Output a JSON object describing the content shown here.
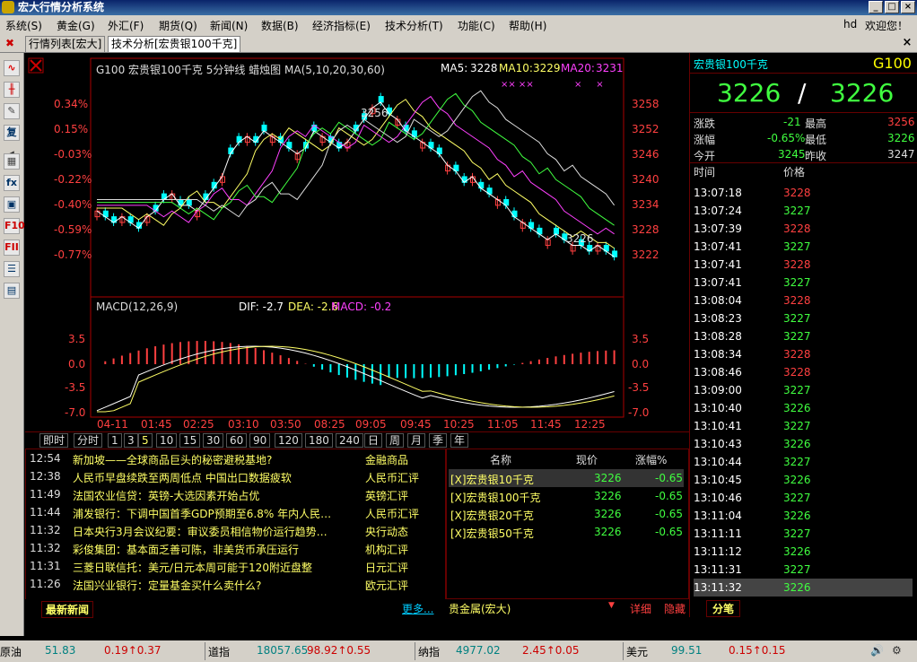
{
  "app": {
    "title": "宏大行情分析系统"
  },
  "menu": {
    "items": [
      "系统(S)",
      "黄金(G)",
      "外汇(F)",
      "期货(Q)",
      "新闻(N)",
      "数据(B)",
      "经济指标(E)",
      "技术分析(T)",
      "功能(C)",
      "帮助(H)"
    ],
    "user": "hd",
    "welcome": "欢迎您！"
  },
  "tabs": [
    "行情列表[宏大]",
    "技术分析[宏贵银100千克]"
  ],
  "chart": {
    "header": "G100 宏贵银100千克 5分钟线 蜡烛图 MA(5,10,20,30,60)",
    "ma5_label": "MA5:",
    "ma5": "3228",
    "ma10_label": "MA10:",
    "ma10": "3229",
    "ma20_label": "MA20:",
    "ma20": "3231",
    "pct_labels": [
      "0.34%",
      "0.15%",
      "-0.03%",
      "-0.22%",
      "-0.40%",
      "-0.59%",
      "-0.77%"
    ],
    "price_labels": [
      "3258",
      "3252",
      "3246",
      "3240",
      "3234",
      "3228",
      "3222"
    ],
    "high_annot": "3256",
    "low_annot": "3226",
    "macd_header": "MACD(12,26,9)",
    "dif": "DIF: -2.7",
    "dea": "DEA: -2.6",
    "macd": "MACD: -0.2",
    "macd_labels": [
      "3.5",
      "0.0",
      "-3.5",
      "-7.0"
    ],
    "x_labels": [
      "04-11",
      "01:45",
      "02:25",
      "03:10",
      "03:50",
      "08:25",
      "09:05",
      "09:45",
      "10:25",
      "11:05",
      "11:45",
      "12:25"
    ]
  },
  "chart_data": {
    "type": "candlestick",
    "title": "G100 宏贵银100千克 5分钟线",
    "ylim": [
      3220,
      3260
    ],
    "high": 3256,
    "low": 3226,
    "last": 3226
  },
  "periods": [
    "即时",
    "分时",
    "1",
    "3",
    "5",
    "10",
    "15",
    "30",
    "60",
    "90",
    "120",
    "180",
    "240",
    "日",
    "周",
    "月",
    "季",
    "年"
  ],
  "news": [
    {
      "time": "12:54",
      "headline": "新加坡——全球商品巨头的秘密避税基地?",
      "cat": "金融商品"
    },
    {
      "time": "12:38",
      "headline": "人民币早盘续跌至两周低点 中国出口数据疲软",
      "cat": "人民币汇评"
    },
    {
      "time": "11:49",
      "headline": "法国农业信贷：英镑-大选因素开始占优",
      "cat": "英镑汇评"
    },
    {
      "time": "11:44",
      "headline": "浦发银行：下调中国首季GDP预期至6.8% 年内人民…",
      "cat": "人民币汇评"
    },
    {
      "time": "11:32",
      "headline": "日本央行3月会议纪要：审议委员相信物价运行趋势…",
      "cat": "央行动态"
    },
    {
      "time": "11:32",
      "headline": "彩俊集团：基本面乏善可陈，非美货币承压运行",
      "cat": "机构汇评"
    },
    {
      "time": "11:31",
      "headline": "三菱日联信托：美元/日元本周可能于120附近盘整",
      "cat": "日元汇评"
    },
    {
      "time": "11:26",
      "headline": "法国兴业银行：定量基金买什么卖什么?",
      "cat": "欧元汇评"
    }
  ],
  "news_tab": "最新新闻",
  "news_more": "更多...",
  "watch": {
    "headers": [
      "名称",
      "现价",
      "涨幅%"
    ],
    "rows": [
      {
        "name": "[X]宏贵银10千克",
        "price": "3226",
        "chg": "-0.65"
      },
      {
        "name": "[X]宏贵银100千克",
        "price": "3226",
        "chg": "-0.65"
      },
      {
        "name": "[X]宏贵银20千克",
        "price": "3226",
        "chg": "-0.65"
      },
      {
        "name": "[X]宏贵银50千克",
        "price": "3226",
        "chg": "-0.65"
      }
    ],
    "footer": "贵金属(宏大)",
    "detail": "详细",
    "hide": "隐藏"
  },
  "quote": {
    "name": "宏贵银100千克",
    "code": "G100",
    "bid": "3226",
    "ask": "3226",
    "sep": "/",
    "chg_label": "涨跌",
    "chg": "-21",
    "high_label": "最高",
    "high": "3256",
    "pct_label": "涨幅",
    "pct": "-0.65%",
    "low_label": "最低",
    "low": "3226",
    "open_label": "今开",
    "open": "3245",
    "prev_label": "昨收",
    "prev": "3247",
    "time_label": "时间",
    "price_label": "价格",
    "tab": "分笔"
  },
  "ticks": [
    [
      "13:07:18",
      "3228"
    ],
    [
      "13:07:24",
      "3227"
    ],
    [
      "13:07:39",
      "3228"
    ],
    [
      "13:07:41",
      "3227"
    ],
    [
      "13:07:41",
      "3228"
    ],
    [
      "13:07:41",
      "3227"
    ],
    [
      "13:08:04",
      "3228"
    ],
    [
      "13:08:23",
      "3227"
    ],
    [
      "13:08:28",
      "3227"
    ],
    [
      "13:08:34",
      "3228"
    ],
    [
      "13:08:46",
      "3228"
    ],
    [
      "13:09:00",
      "3227"
    ],
    [
      "13:10:40",
      "3226"
    ],
    [
      "13:10:41",
      "3227"
    ],
    [
      "13:10:43",
      "3226"
    ],
    [
      "13:10:44",
      "3227"
    ],
    [
      "13:10:45",
      "3226"
    ],
    [
      "13:10:46",
      "3227"
    ],
    [
      "13:11:04",
      "3226"
    ],
    [
      "13:11:11",
      "3227"
    ],
    [
      "13:11:12",
      "3226"
    ],
    [
      "13:11:31",
      "3227"
    ],
    [
      "13:11:32",
      "3226"
    ]
  ],
  "status": [
    {
      "name": "原油",
      "price": "51.83",
      "chg": "0.19↑0.37"
    },
    {
      "name": "道指",
      "price": "18057.65",
      "chg": "98.92↑0.55"
    },
    {
      "name": "纳指",
      "price": "4977.02",
      "chg": "2.45↑0.05"
    },
    {
      "name": "美元",
      "price": "99.51",
      "chg": "0.15↑0.15"
    }
  ]
}
